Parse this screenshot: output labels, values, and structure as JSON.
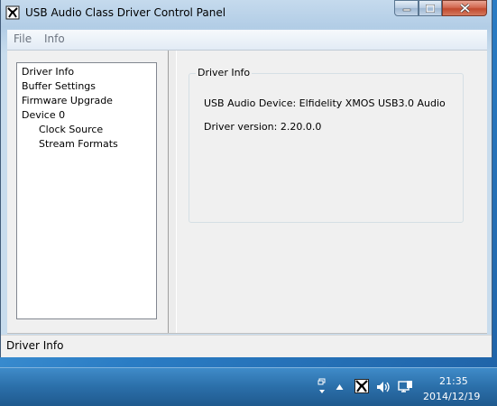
{
  "window": {
    "title": "USB Audio Class Driver Control Panel"
  },
  "menu": {
    "items": [
      {
        "label": "File"
      },
      {
        "label": "Info"
      }
    ]
  },
  "tree": {
    "items": [
      {
        "label": "Driver Info",
        "selected": true
      },
      {
        "label": "Buffer Settings"
      },
      {
        "label": "Firmware Upgrade"
      },
      {
        "label": "Device 0"
      },
      {
        "label": "Clock Source"
      },
      {
        "label": "Stream Formats"
      }
    ]
  },
  "panel": {
    "group_title": "Driver Info",
    "device_line": "USB Audio Device: Elfidelity XMOS USB3.0 Audio",
    "version_line": "Driver version: 2.20.0.0"
  },
  "status": {
    "text": "Driver Info"
  },
  "taskbar": {
    "time": "21:35",
    "date": "2014/12/19"
  },
  "icons": {
    "app": "driver-app-icon",
    "minimize": "minimize-icon",
    "maximize": "maximize-icon",
    "close": "close-icon",
    "tray": [
      "show-desktop-icon",
      "show-hidden-icons-icon",
      "driver-tray-icon",
      "speaker-icon",
      "network-icon"
    ]
  },
  "colors": {
    "title_bar": "#b2cde6",
    "close_button": "#c24a2e",
    "taskbar": "#2b6fa9"
  }
}
